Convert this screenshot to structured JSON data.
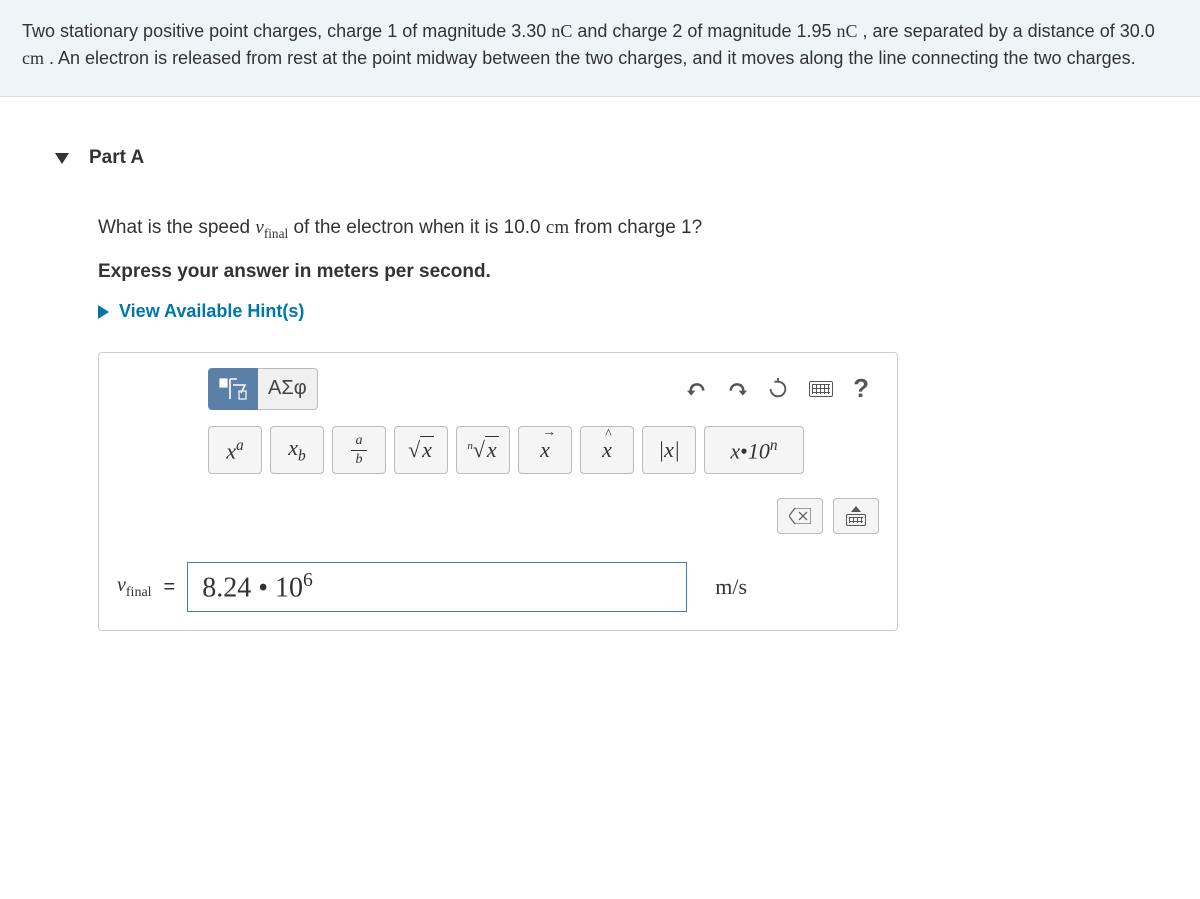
{
  "problem": {
    "text_before_q1": "Two stationary positive point charges, charge 1 of magnitude 3.30 ",
    "q1_unit": "nC",
    "text_between_q": " and charge 2 of magnitude 1.95 ",
    "q2_unit": "nC",
    "text_after_q2": " , are separated by a distance of 30.0 ",
    "dist_unit": "cm",
    "text_rest": " . An electron is released from rest at the point midway between the two charges, and it moves along the line connecting the two charges."
  },
  "part": {
    "label": "Part A",
    "question_pre": "What is the speed ",
    "question_var": "v",
    "question_var_sub": "final",
    "question_mid": " of the electron when it is 10.0 ",
    "question_unit": "cm",
    "question_post": " from charge 1?",
    "instruction": "Express your answer in meters per second.",
    "hints_label": "View Available Hint(s)"
  },
  "toolbar": {
    "greek_label": "ΑΣφ",
    "help_label": "?",
    "superscript": "x",
    "superscript_sup": "a",
    "subscript": "x",
    "subscript_sub": "b",
    "frac_num": "a",
    "frac_den": "b",
    "sqrt": "√x",
    "nroot": "∜x",
    "vector": "x⃗",
    "hat": "x̂",
    "abs": "|x|",
    "sci_base": "x",
    "sci_dot": "•",
    "sci_ten": "10",
    "sci_exp": "n",
    "clear": "⌫"
  },
  "answer": {
    "var": "v",
    "var_sub": "final",
    "equals": "=",
    "value_base": "8.24 • 10",
    "value_exp": "6",
    "units": "m/s"
  }
}
